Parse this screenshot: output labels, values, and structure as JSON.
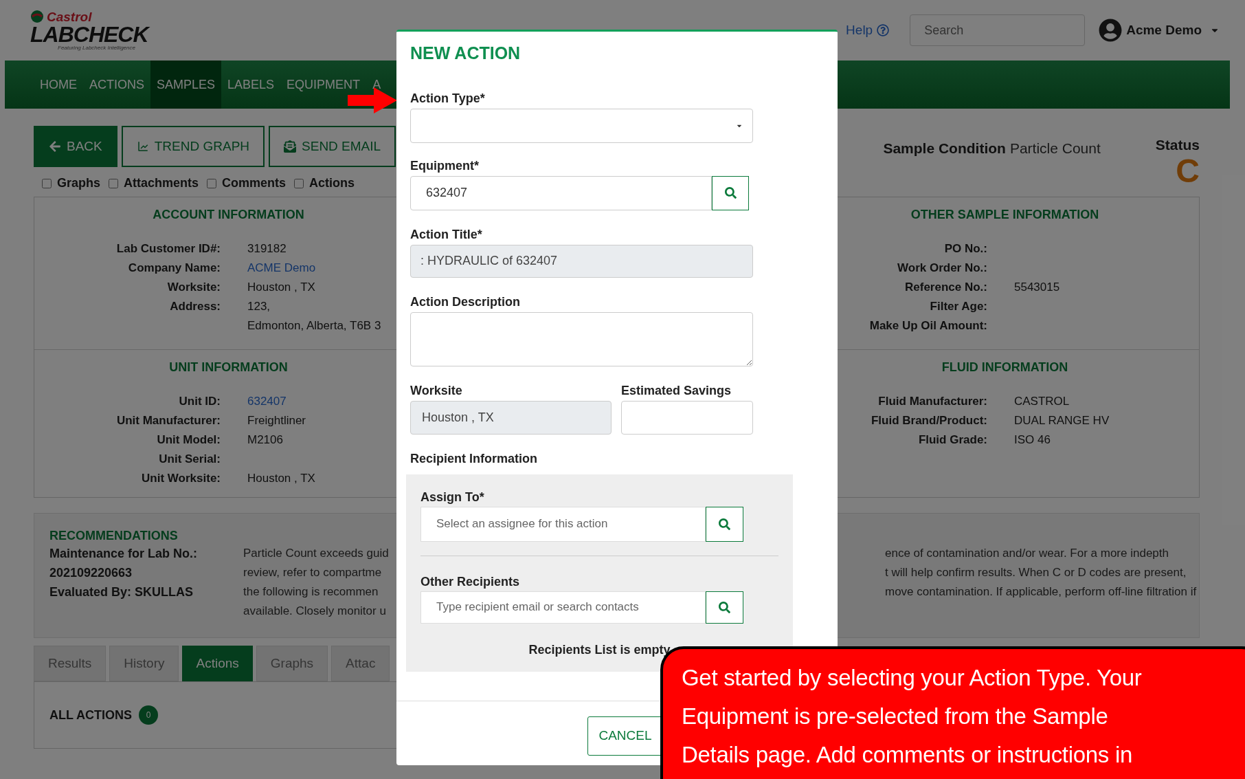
{
  "logo": {
    "brand": "Castrol",
    "product": "LABCHECK",
    "tagline": "Featuring Labcheck Intelligence"
  },
  "header": {
    "help": "Help",
    "search": {
      "placeholder": "Search"
    },
    "user": "Acme Demo"
  },
  "nav": [
    {
      "label": "HOME",
      "selected": false
    },
    {
      "label": "ACTIONS",
      "selected": false
    },
    {
      "label": "SAMPLES",
      "selected": true
    },
    {
      "label": "LABELS",
      "selected": false
    },
    {
      "label": "EQUIPMENT",
      "selected": false
    },
    {
      "label": "A",
      "selected": false
    }
  ],
  "toolbar": [
    {
      "label": "BACK",
      "kind": "back",
      "primary": true
    },
    {
      "label": "TREND GRAPH",
      "kind": "chart",
      "primary": false
    },
    {
      "label": "SEND EMAIL",
      "kind": "email",
      "primary": false
    }
  ],
  "filters": [
    {
      "label": "Graphs",
      "checked": false
    },
    {
      "label": "Attachments",
      "checked": false
    },
    {
      "label": "Comments",
      "checked": false
    },
    {
      "label": "Actions",
      "checked": false
    }
  ],
  "sample_condition": {
    "label": "Sample Condition",
    "value": "Particle Count"
  },
  "status": {
    "label": "Status",
    "value": "C"
  },
  "info_left": [
    {
      "title": "ACCOUNT INFORMATION",
      "rows": [
        {
          "label": "Lab Customer ID#:",
          "value": "319182"
        },
        {
          "label": "Company Name:",
          "value": "ACME Demo",
          "link": true
        },
        {
          "label": "Worksite:",
          "value": "Houston , TX"
        },
        {
          "label": "Address:",
          "value": "123,"
        },
        {
          "label": "",
          "value": "Edmonton, Alberta, T6B 3"
        }
      ]
    },
    {
      "title": "UNIT INFORMATION",
      "rows": [
        {
          "label": "Unit ID:",
          "value": "632407",
          "link": true
        },
        {
          "label": "Unit Manufacturer:",
          "value": "Freightliner"
        },
        {
          "label": "Unit Model:",
          "value": "M2106"
        },
        {
          "label": "Unit Serial:",
          "value": ""
        },
        {
          "label": "Unit Worksite:",
          "value": "Houston , TX"
        }
      ]
    }
  ],
  "info_right": [
    {
      "title": "OTHER SAMPLE INFORMATION",
      "rows": [
        {
          "label": "PO No.:",
          "value": ""
        },
        {
          "label": "Work Order No.:",
          "value": ""
        },
        {
          "label": "Reference No.:",
          "value": "5543015"
        },
        {
          "label": "Filter Age:",
          "value": ""
        },
        {
          "label": "Make Up Oil Amount:",
          "value": ""
        }
      ]
    },
    {
      "title": "FLUID INFORMATION",
      "rows": [
        {
          "label": "Fluid Manufacturer:",
          "value": "CASTROL"
        },
        {
          "label": "Fluid Brand/Product:",
          "value": "DUAL RANGE HV"
        },
        {
          "label": "Fluid Grade:",
          "value": "ISO 46"
        }
      ]
    }
  ],
  "recommendations": {
    "title": "RECOMMENDATIONS",
    "meta": [
      "Maintenance for Lab No.:",
      "202109220663",
      "Evaluated By: SKULLAS"
    ],
    "text_left": [
      "Particle Count exceeds guid",
      "review, refer to compartme",
      "the following is recommen",
      "available. Closely monitor u"
    ],
    "text_right": [
      "ence of contamination and/or wear. For a more indepth",
      "t will help confirm results. When C or D codes are present,",
      "move contamination. If applicable, perform off-line filtration if"
    ]
  },
  "tabs": [
    {
      "label": "Results",
      "selected": false
    },
    {
      "label": "History",
      "selected": false
    },
    {
      "label": "Actions",
      "selected": true
    },
    {
      "label": "Graphs",
      "selected": false
    },
    {
      "label": "Attac",
      "selected": false
    }
  ],
  "actions_panel": {
    "title": "ALL ACTIONS",
    "count": "0"
  },
  "modal": {
    "title": "NEW ACTION",
    "action_type": {
      "label": "Action Type*"
    },
    "equipment": {
      "label": "Equipment*",
      "value": "632407"
    },
    "action_title": {
      "label": "Action Title*",
      "value": ": HYDRAULIC of 632407",
      "disabled": true
    },
    "description": {
      "label": "Action Description"
    },
    "worksite": {
      "label": "Worksite",
      "value": "Houston , TX",
      "disabled": true
    },
    "savings": {
      "label": "Estimated Savings"
    },
    "recipient_heading": "Recipient Information",
    "assign_to": {
      "label": "Assign To*",
      "placeholder": "Select an assignee for this action"
    },
    "other_recipients": {
      "label": "Other Recipients",
      "placeholder": "Type recipient email or search contacts"
    },
    "recipients_empty": "Recipients List is empty",
    "cancel": "CANCEL"
  },
  "callout": {
    "lines": [
      "Get started by selecting your Action Type. Your",
      "Equipment is pre-selected from the Sample",
      "Details page. Add comments or instructions in"
    ]
  }
}
